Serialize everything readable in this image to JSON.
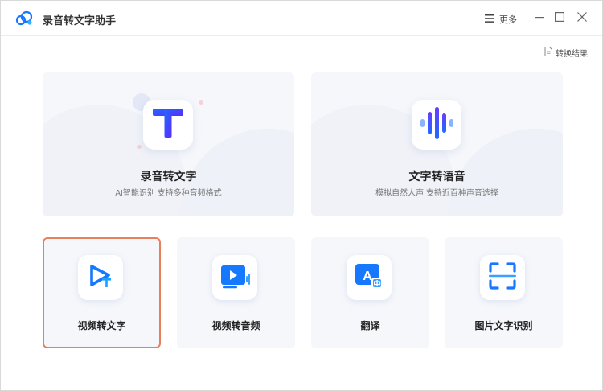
{
  "app": {
    "title": "录音转文字助手",
    "logo_icon": "cloud-logo-icon",
    "accent": "#1677ff",
    "selected_border": "#e8805e"
  },
  "titlebar": {
    "more_label": "更多",
    "more_icon": "menu-lines-icon",
    "window_controls": [
      "minimize-icon",
      "maximize-icon",
      "close-icon"
    ]
  },
  "toolbar": {
    "result_label": "转换结果",
    "result_icon": "document-icon"
  },
  "features": {
    "large": [
      {
        "title": "录音转文字",
        "subtitle": "AI智能识别 支持多种音频格式",
        "icon": "text-t-icon"
      },
      {
        "title": "文字转语音",
        "subtitle": "模拟自然人声 支持近百种声音选择",
        "icon": "sound-wave-icon"
      }
    ],
    "small": [
      {
        "label": "视频转文字",
        "icon": "video-text-icon",
        "selected": true
      },
      {
        "label": "视频转音频",
        "icon": "video-audio-icon",
        "selected": false
      },
      {
        "label": "翻译",
        "icon": "translate-icon",
        "selected": false
      },
      {
        "label": "图片文字识别",
        "icon": "image-scan-icon",
        "selected": false
      }
    ]
  }
}
